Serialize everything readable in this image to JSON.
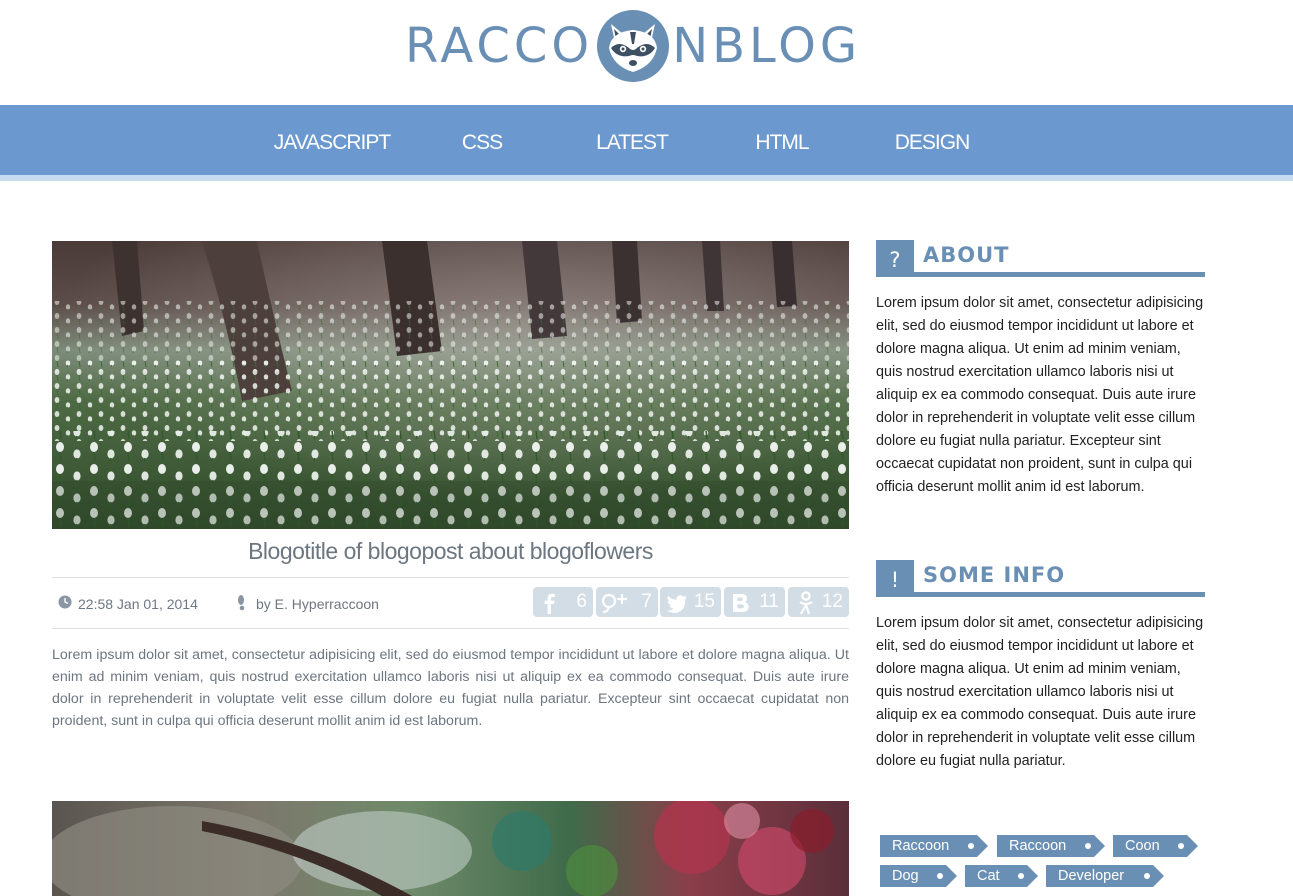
{
  "site": {
    "logo_left": "RACCO",
    "logo_right": "NBLOG",
    "brand_color": "#6a8fb5",
    "logo_icon": "raccoon-face-icon"
  },
  "nav": {
    "color": "#6b99cf",
    "items": [
      {
        "label": "JAVASCRIPT"
      },
      {
        "label": "CSS"
      },
      {
        "label": "LATEST"
      },
      {
        "label": "HTML"
      },
      {
        "label": "DESIGN"
      }
    ]
  },
  "post": {
    "image_subject": "snowdrop-forest-photo",
    "title": "Blogotitle of blogopost about blogoflowers",
    "datetime": "22:58 Jan 01, 2014",
    "author": "by E. Hyperraccoon",
    "shares": [
      {
        "network": "facebook-icon",
        "count": "6"
      },
      {
        "network": "google-plus-icon",
        "count": "7"
      },
      {
        "network": "twitter-icon",
        "count": "15"
      },
      {
        "network": "vk-icon",
        "count": "11"
      },
      {
        "network": "odnoklassniki-icon",
        "count": "12"
      }
    ],
    "body": "Lorem ipsum dolor sit amet, consectetur adipisicing elit, sed do eiusmod tempor incididunt ut labore et dolore magna aliqua. Ut enim ad minim veniam, quis nostrud exercitation ullamco laboris nisi ut aliquip ex ea commodo consequat. Duis aute irure dolor in reprehenderit in voluptate velit esse cillum dolore eu fugiat nulla pariatur. Excepteur sint occaecat cupidatat non proident, sunt in culpa qui officia deserunt mollit anim id est laborum."
  },
  "post2": {
    "image_subject": "paint-palette-photo"
  },
  "sidebar": {
    "about": {
      "icon": "?",
      "title": "ABOUT",
      "text": "Lorem ipsum dolor sit amet, consectetur adipisicing elit, sed do eiusmod tempor incididunt ut labore et dolore magna aliqua. Ut enim ad minim veniam, quis nostrud exercitation ullamco laboris nisi ut aliquip ex ea commodo consequat. Duis aute irure dolor in reprehenderit in voluptate velit esse cillum dolore eu fugiat nulla pariatur. Excepteur sint occaecat cupidatat non proident, sunt in culpa qui officia deserunt mollit anim id est laborum."
    },
    "info": {
      "icon": "!",
      "title": "SOME INFO",
      "text": "Lorem ipsum dolor sit amet, consectetur adipisicing elit, sed do eiusmod tempor incididunt ut labore et dolore magna aliqua. Ut enim ad minim veniam, quis nostrud exercitation ullamco laboris nisi ut aliquip ex ea commodo consequat. Duis aute irure dolor in reprehenderit in voluptate velit esse cillum dolore eu fugiat nulla pariatur."
    },
    "tags": [
      {
        "label": "Raccoon"
      },
      {
        "label": "Raccoon"
      },
      {
        "label": "Coon"
      },
      {
        "label": "Dog"
      },
      {
        "label": "Cat"
      },
      {
        "label": "Developer"
      }
    ]
  }
}
